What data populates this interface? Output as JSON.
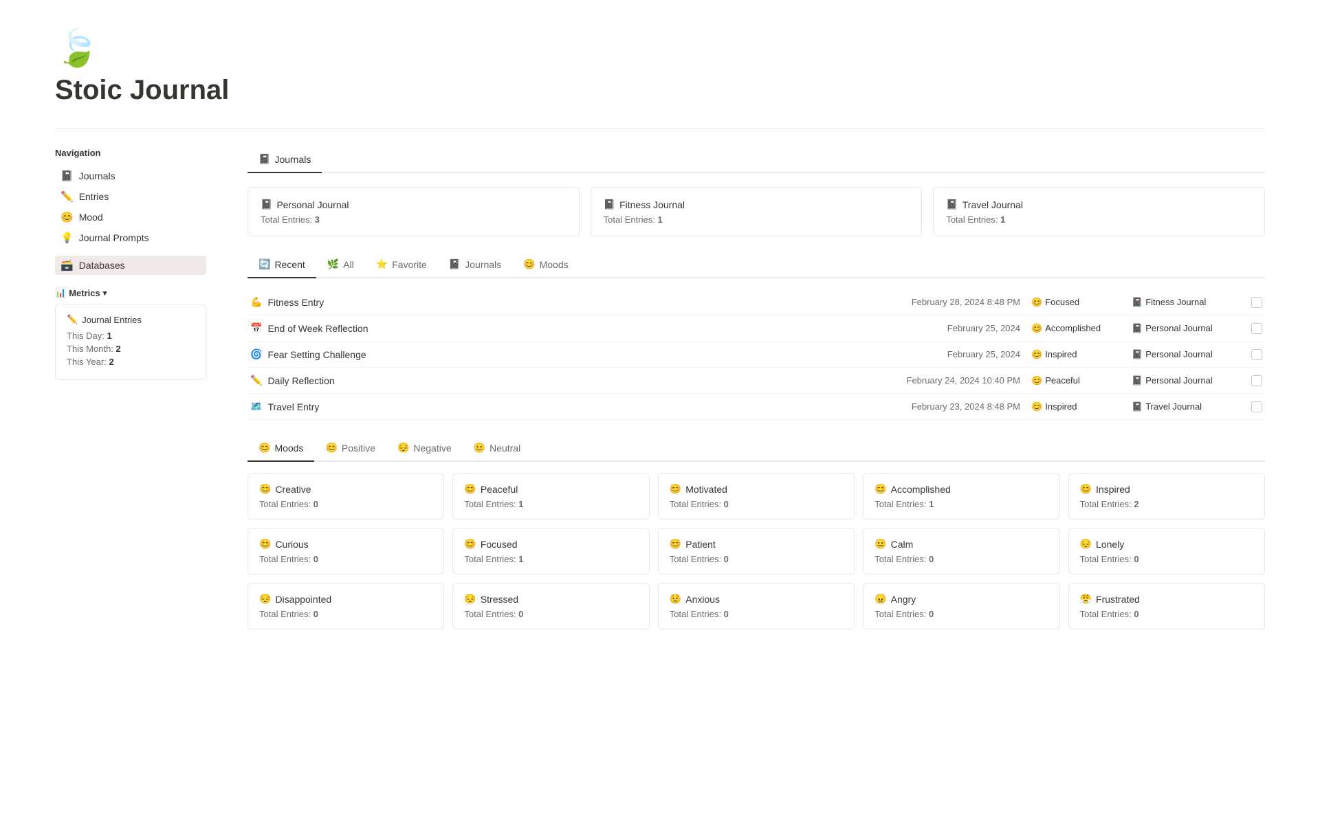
{
  "header": {
    "logo_icon": "🍃",
    "title": "Stoic Journal"
  },
  "sidebar": {
    "nav_title": "Navigation",
    "nav_items": [
      {
        "id": "journals",
        "icon": "📓",
        "label": "Journals",
        "active": false
      },
      {
        "id": "entries",
        "icon": "✏️",
        "label": "Entries",
        "active": false
      },
      {
        "id": "mood",
        "icon": "😊",
        "label": "Mood",
        "active": false
      },
      {
        "id": "journal-prompts",
        "icon": "💡",
        "label": "Journal Prompts",
        "active": false
      }
    ],
    "section_databases": "Databases",
    "metrics_label": "Metrics",
    "metrics_card": {
      "title": "Journal Entries",
      "icon": "✏️",
      "this_day_label": "This Day:",
      "this_day_value": "1",
      "this_month_label": "This Month:",
      "this_month_value": "2",
      "this_year_label": "This Year:",
      "this_year_value": "2"
    }
  },
  "main": {
    "tab_journals": "Journals",
    "journals": {
      "cards": [
        {
          "icon": "📓",
          "title": "Personal Journal",
          "meta": "Total Entries:",
          "count": "3"
        },
        {
          "icon": "📓",
          "title": "Fitness Journal",
          "meta": "Total Entries:",
          "count": "1"
        },
        {
          "icon": "📓",
          "title": "Travel Journal",
          "meta": "Total Entries:",
          "count": "1"
        }
      ]
    },
    "filter_tabs": [
      {
        "id": "recent",
        "icon": "🔄",
        "label": "Recent",
        "active": true
      },
      {
        "id": "all",
        "icon": "🌿",
        "label": "All",
        "active": false
      },
      {
        "id": "favorite",
        "icon": "⭐",
        "label": "Favorite",
        "active": false
      },
      {
        "id": "journals",
        "icon": "📓",
        "label": "Journals",
        "active": false
      },
      {
        "id": "moods",
        "icon": "😊",
        "label": "Moods",
        "active": false
      }
    ],
    "entries": [
      {
        "icon": "💪",
        "title": "Fitness Entry",
        "date": "February 28, 2024 8:48 PM",
        "mood_icon": "😊",
        "mood": "Focused",
        "journal_icon": "📓",
        "journal": "Fitness Journal"
      },
      {
        "icon": "📅",
        "title": "End of Week Reflection",
        "date": "February 25, 2024",
        "mood_icon": "😊",
        "mood": "Accomplished",
        "journal_icon": "📓",
        "journal": "Personal Journal"
      },
      {
        "icon": "🌀",
        "title": "Fear Setting Challenge",
        "date": "February 25, 2024",
        "mood_icon": "😊",
        "mood": "Inspired",
        "journal_icon": "📓",
        "journal": "Personal Journal"
      },
      {
        "icon": "✏️",
        "title": "Daily Reflection",
        "date": "February 24, 2024 10:40 PM",
        "mood_icon": "😊",
        "mood": "Peaceful",
        "journal_icon": "📓",
        "journal": "Personal Journal"
      },
      {
        "icon": "🗺️",
        "title": "Travel Entry",
        "date": "February 23, 2024 8:48 PM",
        "mood_icon": "😊",
        "mood": "Inspired",
        "journal_icon": "📓",
        "journal": "Travel Journal"
      }
    ],
    "moods_section": {
      "filter_tabs": [
        {
          "id": "moods",
          "icon": "😊",
          "label": "Moods",
          "active": true
        },
        {
          "id": "positive",
          "icon": "😊",
          "label": "Positive",
          "active": false
        },
        {
          "id": "negative",
          "icon": "😔",
          "label": "Negative",
          "active": false
        },
        {
          "id": "neutral",
          "icon": "😐",
          "label": "Neutral",
          "active": false
        }
      ],
      "cards": [
        {
          "icon": "😊",
          "title": "Creative",
          "meta": "Total Entries:",
          "count": "0"
        },
        {
          "icon": "😊",
          "title": "Peaceful",
          "meta": "Total Entries:",
          "count": "1"
        },
        {
          "icon": "😊",
          "title": "Motivated",
          "meta": "Total Entries:",
          "count": "0"
        },
        {
          "icon": "😊",
          "title": "Accomplished",
          "meta": "Total Entries:",
          "count": "1"
        },
        {
          "icon": "😊",
          "title": "Inspired",
          "meta": "Total Entries:",
          "count": "2"
        },
        {
          "icon": "😊",
          "title": "Curious",
          "meta": "Total Entries:",
          "count": "0"
        },
        {
          "icon": "😊",
          "title": "Focused",
          "meta": "Total Entries:",
          "count": "1"
        },
        {
          "icon": "😊",
          "title": "Patient",
          "meta": "Total Entries:",
          "count": "0"
        },
        {
          "icon": "😐",
          "title": "Calm",
          "meta": "Total Entries:",
          "count": "0"
        },
        {
          "icon": "😔",
          "title": "Lonely",
          "meta": "Total Entries:",
          "count": "0"
        },
        {
          "icon": "😔",
          "title": "Disappointed",
          "meta": "Total Entries:",
          "count": "0"
        },
        {
          "icon": "😔",
          "title": "Stressed",
          "meta": "Total Entries:",
          "count": "0"
        },
        {
          "icon": "😟",
          "title": "Anxious",
          "meta": "Total Entries:",
          "count": "0"
        },
        {
          "icon": "😠",
          "title": "Angry",
          "meta": "Total Entries:",
          "count": "0"
        },
        {
          "icon": "😤",
          "title": "Frustrated",
          "meta": "Total Entries:",
          "count": "0"
        }
      ]
    }
  }
}
